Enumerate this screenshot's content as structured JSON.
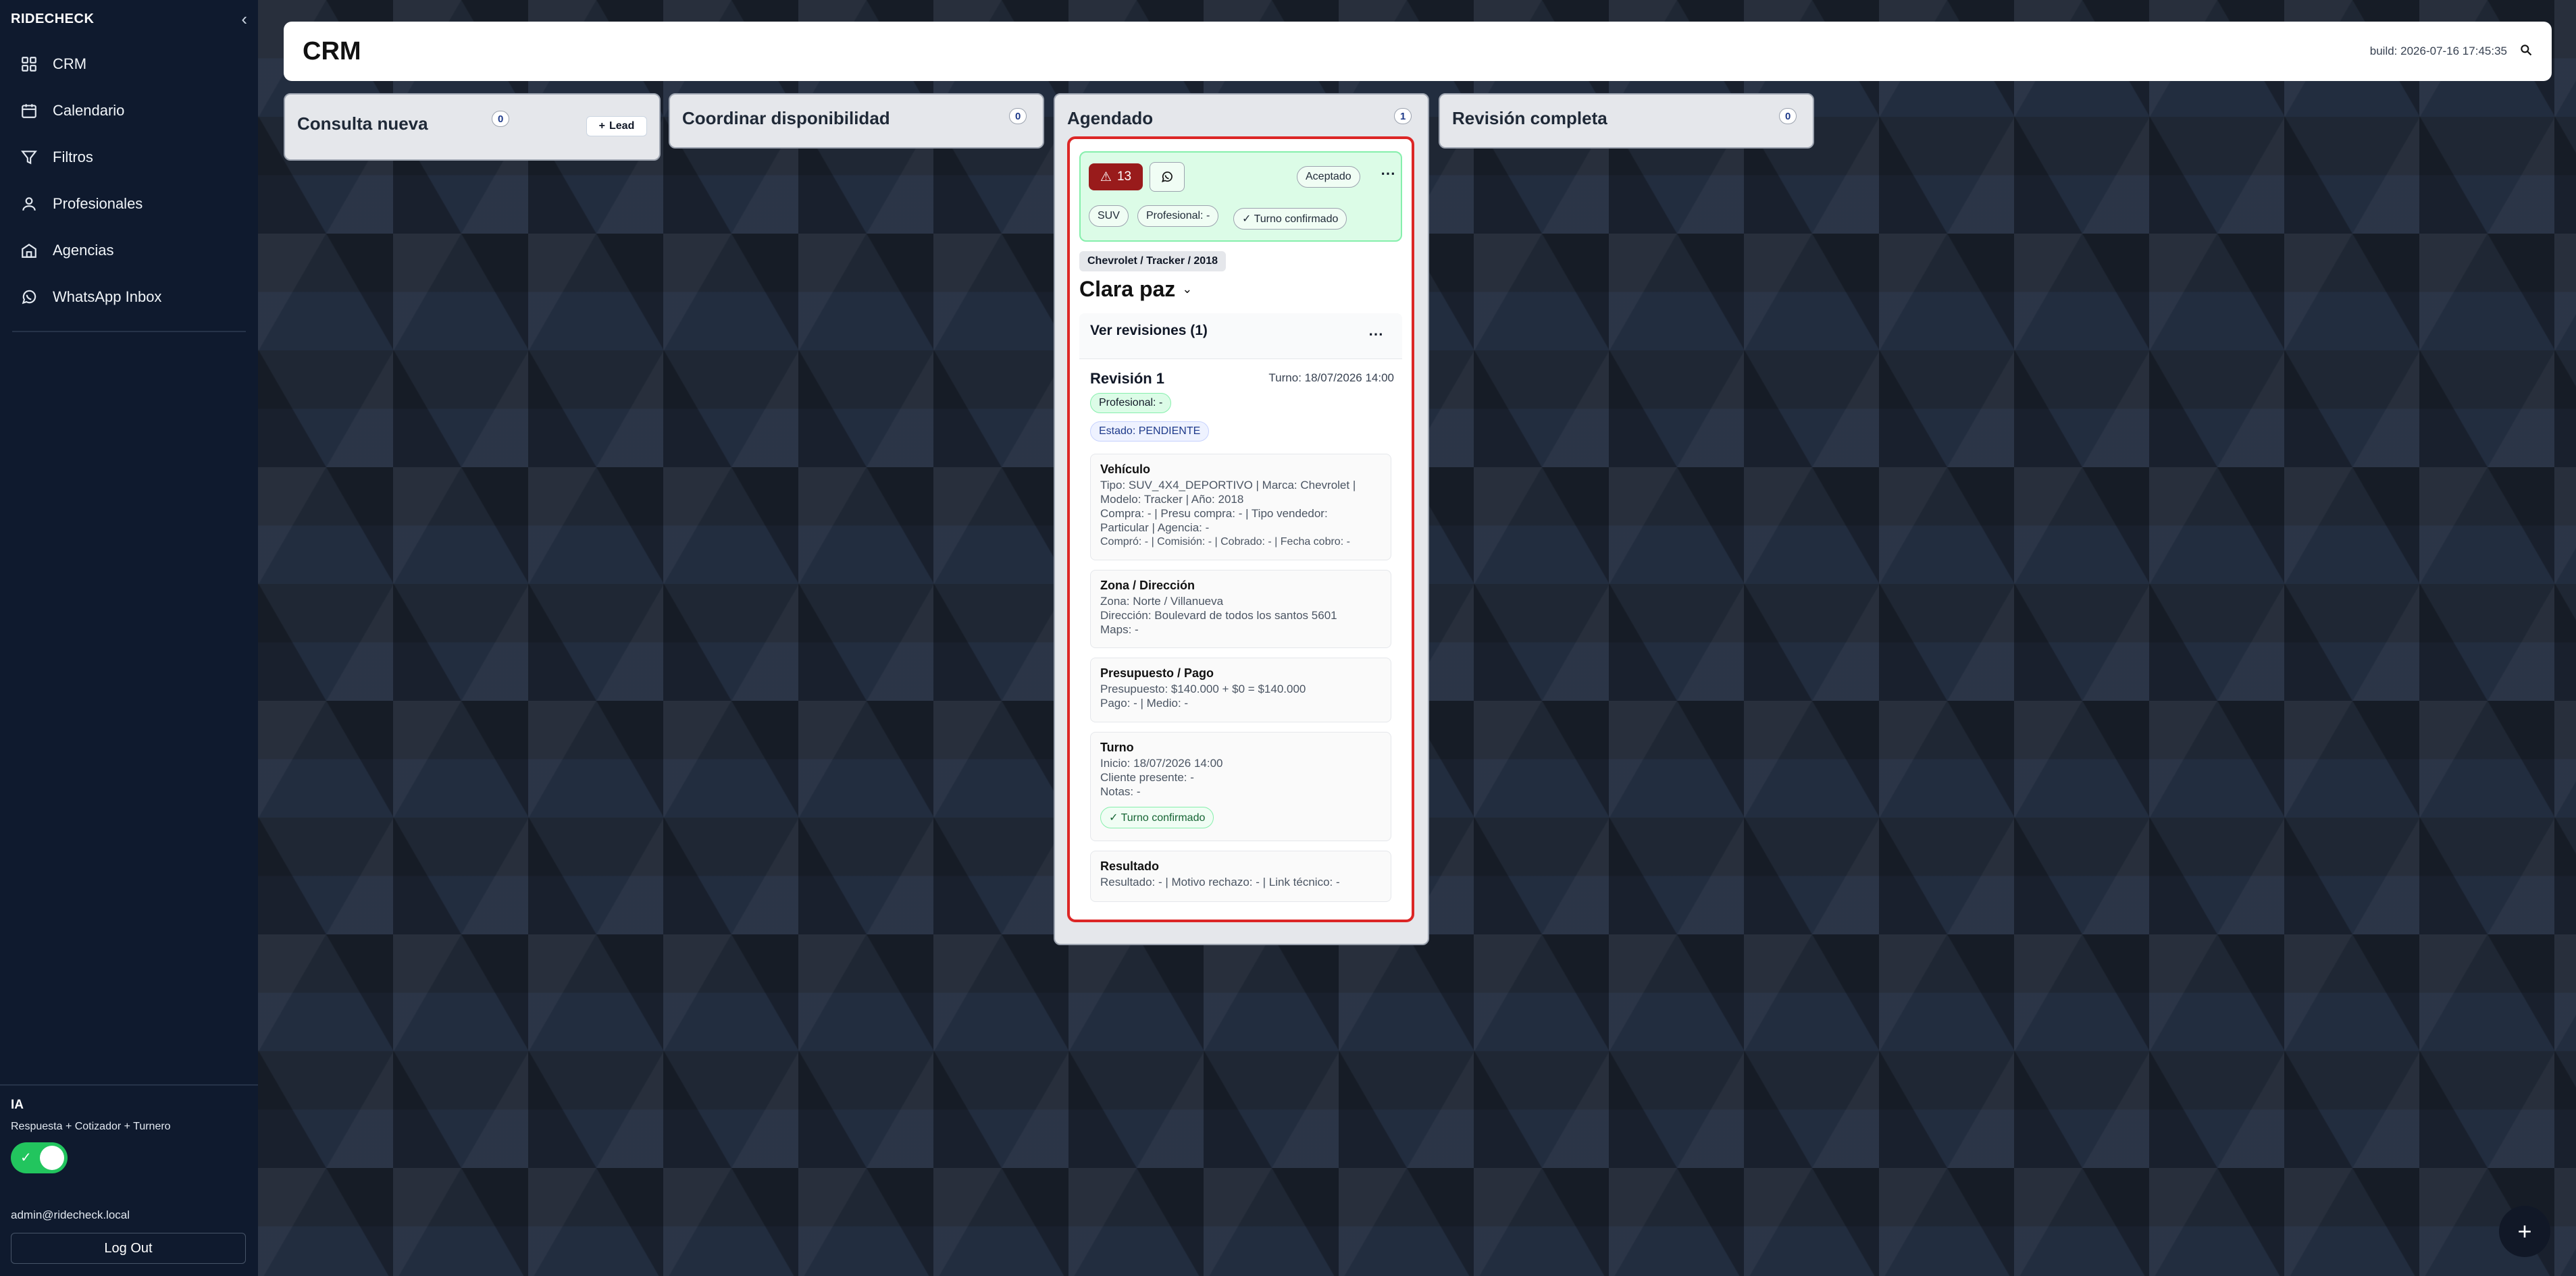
{
  "sidebar": {
    "brand": "RIDECHECK",
    "collapse_icon": "chevron-left-icon",
    "items": [
      {
        "label": "CRM",
        "icon": "grid-icon"
      },
      {
        "label": "Calendario",
        "icon": "calendar-icon"
      },
      {
        "label": "Filtros",
        "icon": "filter-icon"
      },
      {
        "label": "Profesionales",
        "icon": "user-icon"
      },
      {
        "label": "Agencias",
        "icon": "building-icon"
      },
      {
        "label": "WhatsApp Inbox",
        "icon": "whatsapp-icon"
      }
    ],
    "ia": {
      "title": "IA",
      "subtitle": "Respuesta + Cotizador + Turnero",
      "toggle_on": true,
      "toggle_check": "✓"
    },
    "user_email": "admin@ridecheck.local",
    "logout_label": "Log Out"
  },
  "header": {
    "title": "CRM",
    "build": "build: 2026-07-16 17:45:35",
    "search_icon": "search-icon"
  },
  "columns": [
    {
      "title": "Consulta nueva",
      "count": "0",
      "lead_button": "Lead"
    },
    {
      "title": "Coordinar disponibilidad",
      "count": "0"
    },
    {
      "title": "Agendado",
      "count": "1"
    },
    {
      "title": "Revisión completa",
      "count": "0"
    }
  ],
  "card": {
    "alert_count": "13",
    "alert_icon": "warning-icon",
    "status": "Aceptado",
    "type_tag": "SUV",
    "professional": "Profesional: -",
    "turno_confirmado": "✓ Turno confirmado",
    "vehicle": "Chevrolet / Tracker / 2018",
    "client_name": "Clara paz",
    "revisions_title": "Ver revisiones (1)",
    "revision": {
      "title": "Revisión 1",
      "turno": "Turno: 18/07/2026 14:00",
      "professional": "Profesional: -",
      "estado": "Estado: PENDIENTE",
      "sections": {
        "vehiculo": {
          "title": "Vehículo",
          "lines": [
            "Tipo: SUV_4X4_DEPORTIVO | Marca: Chevrolet |",
            "Modelo: Tracker | Año: 2018",
            "Compra: - | Presu compra: - | Tipo vendedor:",
            "Particular | Agencia: -",
            "Compró: - | Comisión: - | Cobrado: - | Fecha cobro: -"
          ]
        },
        "zona": {
          "title": "Zona / Dirección",
          "lines": [
            "Zona: Norte / Villanueva",
            "Dirección: Boulevard de todos los santos 5601",
            "Maps: -"
          ]
        },
        "presupuesto": {
          "title": "Presupuesto / Pago",
          "lines": [
            "Presupuesto: $140.000 + $0 = $140.000",
            "Pago: - | Medio: -"
          ]
        },
        "turno": {
          "title": "Turno",
          "lines": [
            "Inicio: 18/07/2026 14:00",
            "Cliente presente: -",
            "Notas: -"
          ],
          "badge": "✓ Turno confirmado"
        },
        "resultado": {
          "title": "Resultado",
          "lines": [
            "Resultado: - | Motivo rechazo: - | Link técnico: -"
          ]
        }
      }
    }
  },
  "fab_label": "+"
}
